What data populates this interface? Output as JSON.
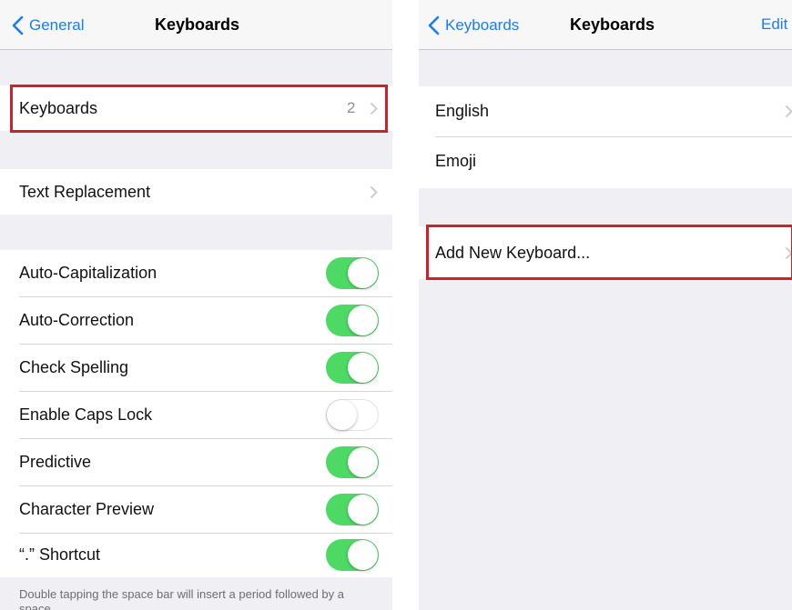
{
  "left": {
    "nav": {
      "back_label": "General",
      "title": "Keyboards"
    },
    "keyboards_row": {
      "label": "Keyboards",
      "value": "2"
    },
    "text_replacement_label": "Text Replacement",
    "toggles": [
      {
        "label": "Auto-Capitalization",
        "on": true
      },
      {
        "label": "Auto-Correction",
        "on": true
      },
      {
        "label": "Check Spelling",
        "on": true
      },
      {
        "label": "Enable Caps Lock",
        "on": false
      },
      {
        "label": "Predictive",
        "on": true
      },
      {
        "label": "Character Preview",
        "on": true
      },
      {
        "label": "“.” Shortcut",
        "on": true
      }
    ],
    "footer": "Double tapping the space bar will insert a period followed by a space."
  },
  "right": {
    "nav": {
      "back_label": "Keyboards",
      "title": "Keyboards",
      "action": "Edit"
    },
    "keyboards": [
      "English",
      "Emoji"
    ],
    "add_label": "Add New Keyboard..."
  },
  "colors": {
    "accent": "#1a7cf5",
    "toggle_on": "#4cd964",
    "highlight": "#d32027"
  }
}
